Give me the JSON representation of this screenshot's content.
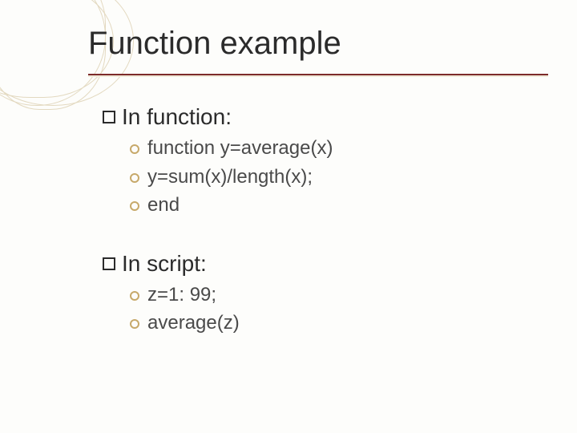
{
  "title": "Function example",
  "sections": [
    {
      "heading": "In function:",
      "items": [
        "function y=average(x)",
        "y=sum(x)/length(x);",
        "end"
      ]
    },
    {
      "heading": "In script:",
      "items": [
        "z=1: 99;",
        "average(z)"
      ]
    }
  ]
}
